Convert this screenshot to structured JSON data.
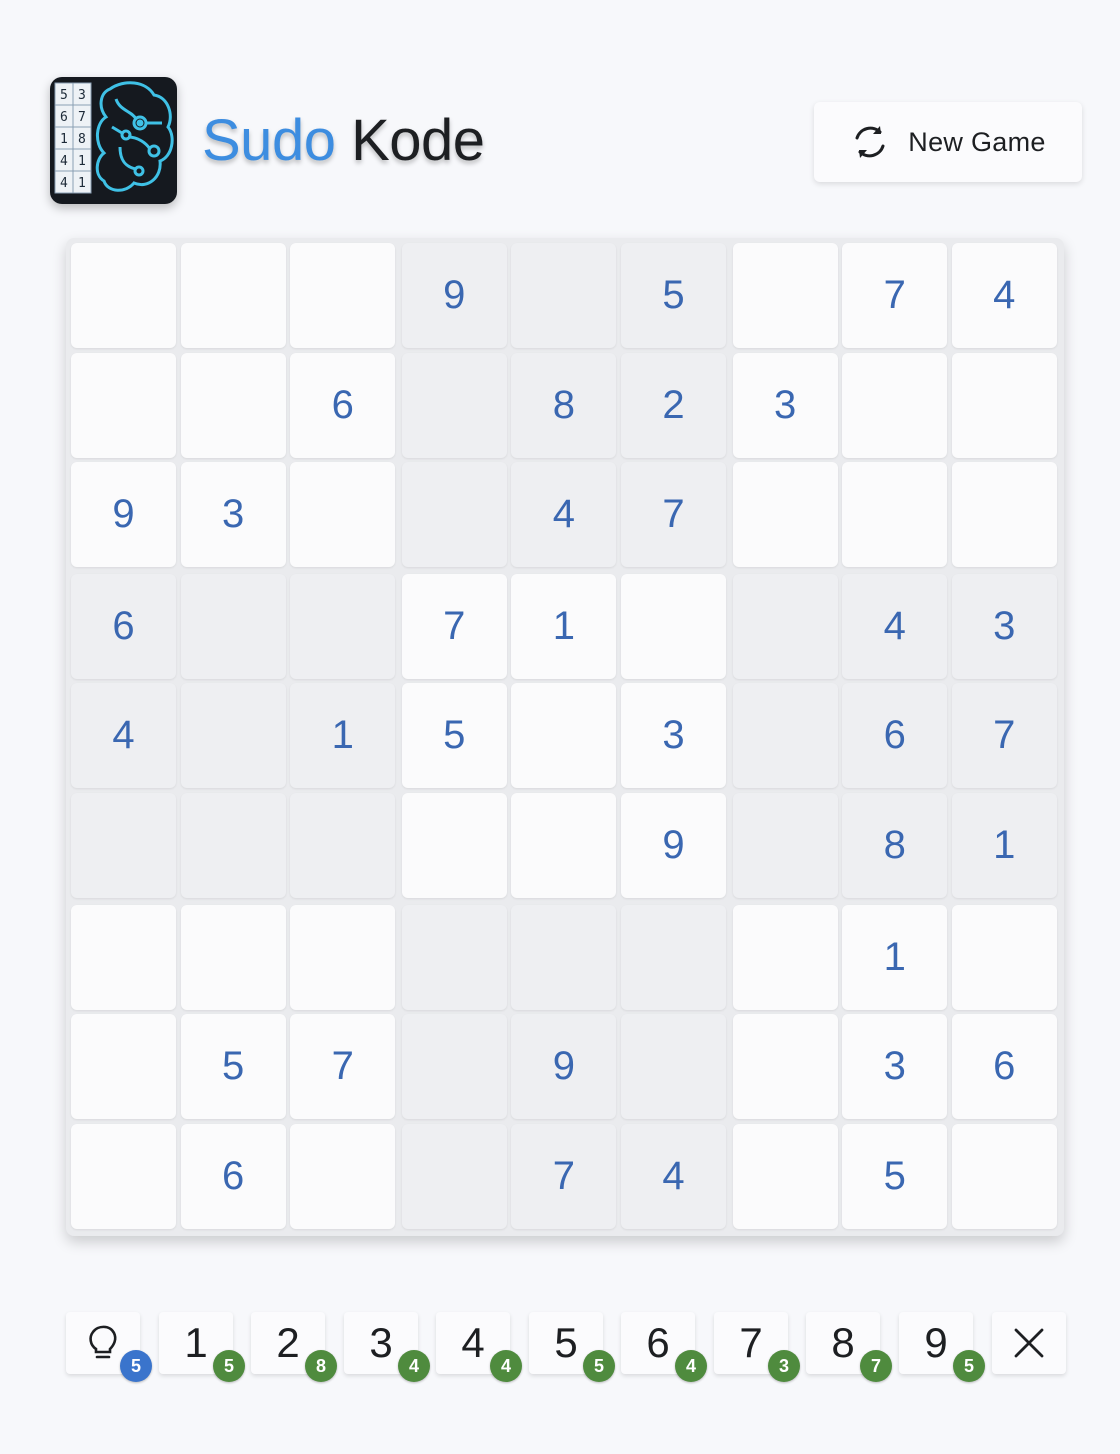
{
  "header": {
    "logo_icon": "sudoku-brain-logo-icon",
    "logo_grid_digits": [
      [
        "5",
        "3"
      ],
      [
        "6",
        "7"
      ],
      [
        "1",
        "8"
      ],
      [
        "4",
        "1"
      ],
      [
        "4",
        "1"
      ]
    ],
    "brand_part1": "Sudo",
    "brand_part2": "Kode",
    "brand_colors": {
      "part1": "#3d8de0",
      "part2": "#1d1f22"
    },
    "new_game_label": "New Game",
    "new_game_icon": "refresh-icon"
  },
  "board": {
    "digit_color": "#3a67b1",
    "rows": [
      [
        "",
        "",
        "",
        "9",
        "",
        "5",
        "",
        "7",
        "4"
      ],
      [
        "",
        "",
        "6",
        "",
        "8",
        "2",
        "3",
        "",
        ""
      ],
      [
        "9",
        "3",
        "",
        "",
        "4",
        "7",
        "",
        "",
        ""
      ],
      [
        "6",
        "",
        "",
        "7",
        "1",
        "",
        "",
        "4",
        "3"
      ],
      [
        "4",
        "",
        "1",
        "5",
        "",
        "3",
        "",
        "6",
        "7"
      ],
      [
        "",
        "",
        "",
        "",
        "",
        "9",
        "",
        "8",
        "1"
      ],
      [
        "",
        "",
        "",
        "",
        "",
        "",
        "",
        "1",
        ""
      ],
      [
        "",
        "5",
        "7",
        "",
        "9",
        "",
        "",
        "3",
        "6"
      ],
      [
        "",
        "6",
        "",
        "",
        "7",
        "4",
        "",
        "5",
        ""
      ]
    ]
  },
  "keypad": {
    "hint": {
      "icon": "lightbulb-icon",
      "count": "5",
      "badge_color": "#3a74cc"
    },
    "digits": [
      {
        "label": "1",
        "count": "5"
      },
      {
        "label": "2",
        "count": "8"
      },
      {
        "label": "3",
        "count": "4"
      },
      {
        "label": "4",
        "count": "4"
      },
      {
        "label": "5",
        "count": "5"
      },
      {
        "label": "6",
        "count": "4"
      },
      {
        "label": "7",
        "count": "3"
      },
      {
        "label": "8",
        "count": "7"
      },
      {
        "label": "9",
        "count": "5"
      }
    ],
    "count_badge_color": "#4f8b3e",
    "clear": {
      "icon": "close-icon"
    }
  }
}
